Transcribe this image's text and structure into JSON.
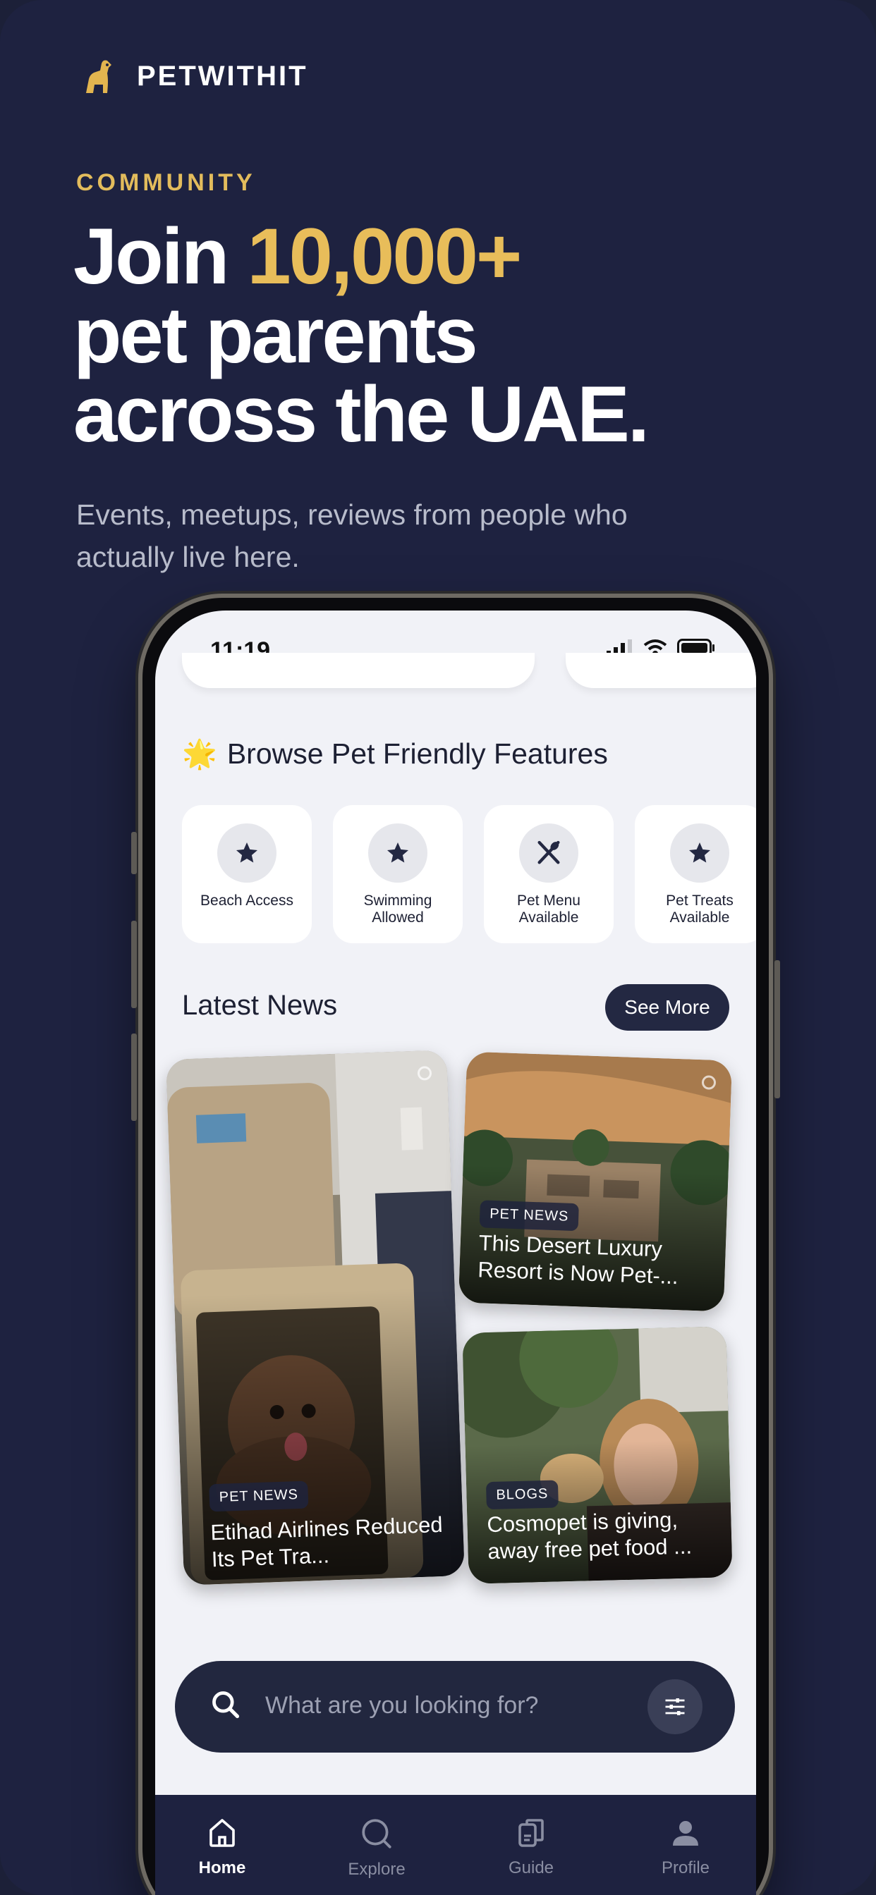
{
  "brand": {
    "name": "PETWITHIT",
    "logo_icon": "dog-logo-icon"
  },
  "hero": {
    "eyebrow": "COMMUNITY",
    "headline_prefix": "Join ",
    "headline_accent": "10,000+",
    "headline_line2": "pet parents",
    "headline_line3": "across the UAE.",
    "subheadline": "Events, meetups, reviews from people who actually live here."
  },
  "colors": {
    "accent": "#e8bd5a",
    "background": "#1e2240",
    "button": "#232842"
  },
  "status_bar": {
    "time": "11:19"
  },
  "features": {
    "title": "Browse Pet Friendly Features",
    "title_icon": "star-emoji-icon",
    "items": [
      {
        "label": "Beach Access",
        "icon": "star-icon"
      },
      {
        "label": "Swimming Allowed",
        "icon": "star-icon"
      },
      {
        "label": "Pet Menu Available",
        "icon": "cutlery-icon"
      },
      {
        "label": "Pet Treats Available",
        "icon": "star-icon"
      }
    ]
  },
  "news": {
    "title": "Latest News",
    "see_more": "See More",
    "cards": [
      {
        "tag": "PET NEWS",
        "title": "Etihad Airlines Reduced Its Pet Tra..."
      },
      {
        "tag": "PET NEWS",
        "title": "This Desert Luxury Resort is Now Pet-..."
      },
      {
        "tag": "BLOGS",
        "title": "Cosmopet is giving, away free pet food ..."
      }
    ]
  },
  "search": {
    "placeholder": "What are you looking for?"
  },
  "tabs": [
    {
      "label": "Home",
      "icon": "home-icon",
      "active": true
    },
    {
      "label": "Explore",
      "icon": "search-icon",
      "active": false
    },
    {
      "label": "Guide",
      "icon": "guide-icon",
      "active": false
    },
    {
      "label": "Profile",
      "icon": "profile-icon",
      "active": false
    }
  ]
}
